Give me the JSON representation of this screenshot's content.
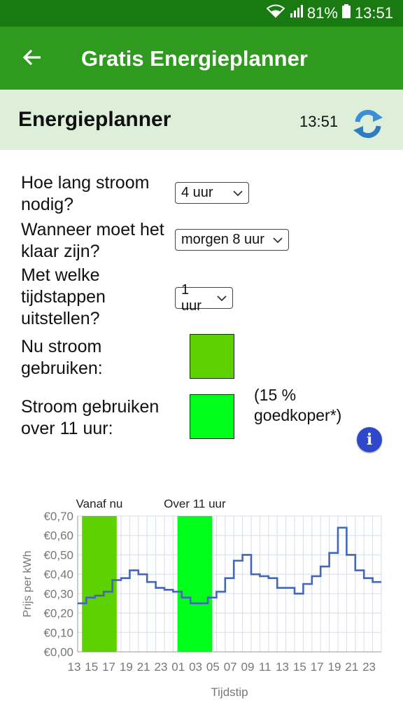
{
  "status": {
    "battery": "81%",
    "time": "13:51"
  },
  "appbar": {
    "title": "Gratis Energieplanner"
  },
  "header": {
    "title": "Energieplanner",
    "time": "13:51"
  },
  "form": {
    "q1": "Hoe lang stroom\nnodig?",
    "q1_value": "4 uur",
    "q2": "Wanneer moet het\nklaar zijn?",
    "q2_value": "morgen 8 uur",
    "q3": "Met welke\ntijdstappen\nuitstellen?",
    "q3_value": "1 uur",
    "now_label": "Nu stroom\ngebruiken:",
    "later_label": "Stroom gebruiken\nover 11 uur:",
    "saving_note": "(15 %\ngoedkoper*)"
  },
  "colors": {
    "now": "#5dd200",
    "later": "#00ff1a",
    "line": "#4466bb",
    "appbar": "#2e9b1e"
  },
  "chart_data": {
    "type": "line",
    "xlabel": "Tijdstip",
    "ylabel": "Prijs per kWh",
    "ylim": [
      0,
      0.7
    ],
    "yticks": [
      "€0,00",
      "€0,10",
      "€0,20",
      "€0,30",
      "€0,40",
      "€0,50",
      "€0,60",
      "€0,70"
    ],
    "xticks": [
      "13",
      "15",
      "17",
      "19",
      "21",
      "23",
      "01",
      "03",
      "05",
      "07",
      "09",
      "11",
      "13",
      "15",
      "17",
      "19",
      "21",
      "23"
    ],
    "x": [
      "13",
      "14",
      "15",
      "16",
      "17",
      "18",
      "19",
      "20",
      "21",
      "22",
      "23",
      "00",
      "01",
      "02",
      "03",
      "04",
      "05",
      "06",
      "07",
      "08",
      "09",
      "10",
      "11",
      "12",
      "13",
      "14",
      "15",
      "16",
      "17",
      "18",
      "19",
      "20",
      "21",
      "22",
      "23"
    ],
    "values": [
      0.25,
      0.28,
      0.29,
      0.31,
      0.37,
      0.38,
      0.42,
      0.4,
      0.36,
      0.33,
      0.32,
      0.31,
      0.28,
      0.25,
      0.25,
      0.28,
      0.31,
      0.38,
      0.47,
      0.5,
      0.4,
      0.39,
      0.38,
      0.33,
      0.33,
      0.3,
      0.35,
      0.39,
      0.44,
      0.51,
      0.64,
      0.5,
      0.42,
      0.38,
      0.36
    ],
    "highlights": [
      {
        "label": "Vanaf nu",
        "start_hour_index": 0.5,
        "end_hour_index": 4.5
      },
      {
        "label": "Over 11 uur",
        "start_hour_index": 11.5,
        "end_hour_index": 15.5
      }
    ]
  }
}
